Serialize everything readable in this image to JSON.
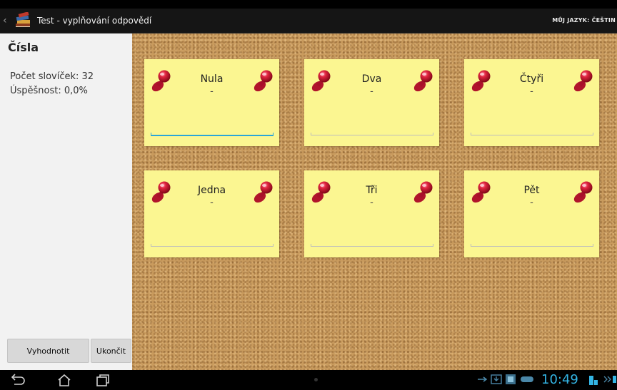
{
  "app": {
    "title": "Test - vyplňování odpovědí",
    "language_label": "MŮJ JAZYK: ČEŠTIN"
  },
  "sidebar": {
    "heading": "Čísla",
    "word_count": "Počet slovíček: 32",
    "success_rate": "Úspěšnost: 0,0%",
    "evaluate_button": "Vyhodnotit",
    "end_button": "Ukončit"
  },
  "cards": [
    {
      "word": "Nula",
      "hint": "-",
      "answer": "",
      "focused": true
    },
    {
      "word": "Dva",
      "hint": "-",
      "answer": "",
      "focused": false
    },
    {
      "word": "Čtyři",
      "hint": "-",
      "answer": "",
      "focused": false
    },
    {
      "word": "Jedna",
      "hint": "-",
      "answer": "",
      "focused": false
    },
    {
      "word": "Tři",
      "hint": "-",
      "answer": "",
      "focused": false
    },
    {
      "word": "Pět",
      "hint": "-",
      "answer": "",
      "focused": false
    }
  ],
  "status_bar": {
    "time": "10:49"
  },
  "colors": {
    "note": "#fbf691",
    "focus_accent": "#2aa6d8",
    "clock": "#33b5e5",
    "pin": "#c8102e"
  }
}
